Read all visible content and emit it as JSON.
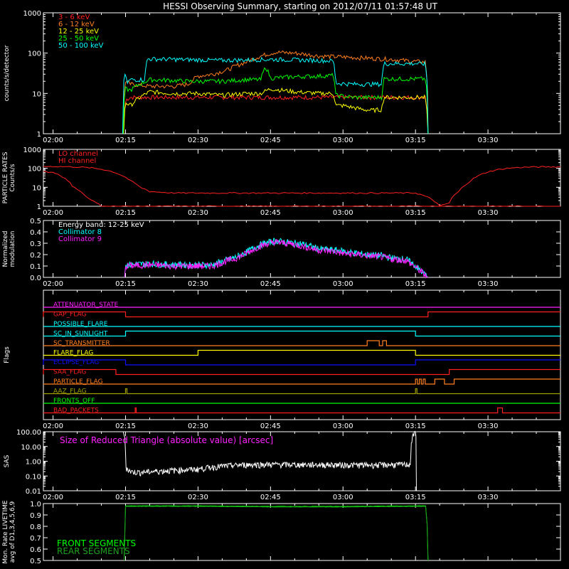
{
  "title": "HESSI Observing Summary, starting on 2012/07/11 01:57:48 UT",
  "colors": {
    "background": "#000000",
    "axis": "#ffffff",
    "red": "#ff2020",
    "orange": "#ff7f1f",
    "yellow": "#ffff00",
    "green": "#00ff00",
    "cyan": "#00ffff",
    "magenta": "#ff20ff",
    "blue": "#1010ff",
    "olive": "#a0a000",
    "white": "#ffffff",
    "darkgreen": "#20a020"
  },
  "time_axis": {
    "start_min": 118,
    "end_min": 225,
    "ticks": [
      {
        "t": 120,
        "label": "02:00"
      },
      {
        "t": 135,
        "label": "02:15"
      },
      {
        "t": 150,
        "label": "02:30"
      },
      {
        "t": 165,
        "label": "02:45"
      },
      {
        "t": 180,
        "label": "03:00"
      },
      {
        "t": 195,
        "label": "03:15"
      },
      {
        "t": 210,
        "label": "03:30"
      }
    ]
  },
  "chart_data": [
    {
      "type": "line",
      "panel": "count-rates",
      "ylabel": "counts/s/detector",
      "yscale": "log",
      "ylim": [
        1,
        1000
      ],
      "yticks": [
        {
          "v": 1,
          "label": "1"
        },
        {
          "v": 10,
          "label": "10"
        },
        {
          "v": 100,
          "label": "100"
        },
        {
          "v": 1000,
          "label": "1000"
        }
      ],
      "x_unit": "minutes of day (UT)",
      "series": [
        {
          "name": "3 - 6 keV",
          "color": "#ff2020",
          "x": [
            134.5,
            135.1,
            136,
            140,
            145,
            150,
            155,
            160,
            165,
            170,
            175,
            180,
            185,
            188,
            190,
            195,
            197,
            197.6
          ],
          "y": [
            1,
            7,
            8,
            8,
            8,
            8,
            8,
            8,
            8,
            8,
            8,
            8,
            8,
            8,
            8,
            8,
            8,
            1
          ]
        },
        {
          "name": "6 - 12 keV",
          "color": "#ff7f1f",
          "x": [
            134.5,
            135,
            136,
            140,
            145,
            148,
            150,
            153,
            156,
            160,
            163,
            166,
            170,
            175,
            180,
            185,
            190,
            195,
            197,
            197.6
          ],
          "y": [
            1,
            20,
            17,
            15,
            15,
            17,
            27,
            30,
            38,
            60,
            85,
            105,
            100,
            85,
            80,
            75,
            70,
            62,
            60,
            1
          ]
        },
        {
          "name": "12 - 25 keV",
          "color": "#ffff00",
          "x": [
            134.6,
            135,
            136,
            140,
            145,
            150,
            155,
            160,
            163,
            165,
            170,
            175,
            178,
            178.5,
            180,
            184,
            186,
            188,
            188.5,
            190,
            195,
            197,
            197.6
          ],
          "y": [
            1,
            6,
            5,
            11,
            10,
            10,
            9,
            10,
            10,
            13,
            11,
            10,
            10,
            5,
            5,
            4,
            3.8,
            4,
            8,
            8,
            8,
            8,
            1
          ]
        },
        {
          "name": "25 - 50 keV",
          "color": "#00ff00",
          "x": [
            134.5,
            135,
            136,
            140,
            145,
            148,
            150,
            155,
            160,
            163,
            164,
            165,
            170,
            175,
            178,
            178.5,
            182,
            185,
            188,
            188.5,
            190,
            195,
            197,
            197.6
          ],
          "y": [
            1,
            13,
            12,
            22,
            21,
            20,
            20,
            20,
            22,
            22,
            45,
            24,
            26,
            27,
            28,
            9,
            8,
            8,
            8,
            23,
            23,
            23,
            23,
            1
          ]
        },
        {
          "name": "50 - 100 keV",
          "color": "#00ffff",
          "x": [
            134.4,
            134.8,
            135.3,
            136,
            139,
            139.5,
            145,
            150,
            155,
            160,
            165,
            170,
            175,
            178,
            178.5,
            182,
            185,
            188,
            188.5,
            190,
            195,
            197,
            197.6
          ],
          "y": [
            1,
            33,
            18,
            22,
            22,
            72,
            70,
            68,
            66,
            68,
            70,
            68,
            66,
            64,
            18,
            17,
            17,
            17,
            55,
            55,
            55,
            54,
            1
          ]
        }
      ]
    },
    {
      "type": "line",
      "panel": "particle-rates",
      "ylabel": "PARTICLE RATES\nCounts/s",
      "yscale": "log",
      "ylim": [
        1,
        1000
      ],
      "yticks": [
        {
          "v": 1,
          "label": "1"
        },
        {
          "v": 10,
          "label": "10"
        },
        {
          "v": 100,
          "label": "100"
        },
        {
          "v": 1000,
          "label": "1000"
        }
      ],
      "series": [
        {
          "name": "LO channel",
          "color": "#ff2020",
          "x": [
            118,
            120,
            122,
            124,
            126,
            128,
            130,
            132,
            134,
            136,
            138,
            140,
            145,
            150,
            155,
            160,
            165,
            170,
            175,
            180,
            185,
            190,
            195,
            200,
            202,
            204,
            206,
            208,
            210,
            212,
            214,
            216,
            218,
            220,
            225
          ],
          "y": [
            125,
            125,
            123,
            120,
            115,
            105,
            90,
            70,
            45,
            22,
            10,
            6,
            5,
            5,
            5,
            5,
            5,
            5,
            5,
            5,
            5,
            5,
            5,
            1,
            1.5,
            6,
            18,
            40,
            65,
            85,
            100,
            110,
            115,
            118,
            120
          ]
        },
        {
          "name": "HI channel",
          "color": "#ff2020",
          "x": [
            118,
            120,
            121,
            122,
            123,
            124,
            125,
            126,
            127,
            128,
            129,
            130,
            132,
            135,
            140,
            145,
            150,
            160,
            170,
            180,
            190,
            195,
            200,
            202,
            203,
            210,
            225
          ],
          "y": [
            70,
            60,
            50,
            35,
            22,
            12,
            8,
            5,
            3,
            2,
            1.5,
            1,
            1,
            1,
            1,
            1,
            1,
            1,
            1,
            1,
            1,
            1,
            1,
            1,
            1,
            1,
            1
          ]
        }
      ]
    },
    {
      "type": "line",
      "panel": "modulation",
      "ylabel": "Normalized\nmodulation",
      "yscale": "linear",
      "ylim": [
        0,
        0.5
      ],
      "yticks": [
        {
          "v": 0,
          "label": "0.0"
        },
        {
          "v": 0.1,
          "label": "0.1"
        },
        {
          "v": 0.2,
          "label": "0.2"
        },
        {
          "v": 0.3,
          "label": "0.3"
        },
        {
          "v": 0.4,
          "label": "0.4"
        },
        {
          "v": 0.5,
          "label": "0.5"
        }
      ],
      "legend_header": "Energy band: 12-25 keV",
      "series": [
        {
          "name": "Collimator 8",
          "color": "#00ffff",
          "x": [
            134.8,
            135,
            140,
            145,
            150,
            153,
            155,
            158,
            160,
            162,
            164,
            166,
            168,
            170,
            172,
            175,
            178,
            180,
            183,
            185,
            188,
            190,
            193,
            195,
            197.6
          ],
          "y": [
            0,
            0.11,
            0.12,
            0.11,
            0.11,
            0.11,
            0.14,
            0.18,
            0.22,
            0.27,
            0.3,
            0.32,
            0.31,
            0.3,
            0.29,
            0.25,
            0.24,
            0.23,
            0.21,
            0.2,
            0.19,
            0.17,
            0.16,
            0.1,
            0
          ]
        },
        {
          "name": "Collimator 9",
          "color": "#ff20ff",
          "x": [
            134.8,
            135,
            140,
            145,
            150,
            153,
            155,
            158,
            160,
            162,
            164,
            166,
            168,
            170,
            172,
            175,
            178,
            180,
            183,
            185,
            188,
            190,
            193,
            195,
            197.6
          ],
          "y": [
            0,
            0.1,
            0.11,
            0.1,
            0.1,
            0.1,
            0.13,
            0.17,
            0.21,
            0.26,
            0.29,
            0.31,
            0.3,
            0.29,
            0.27,
            0.24,
            0.23,
            0.21,
            0.2,
            0.19,
            0.18,
            0.16,
            0.15,
            0.09,
            0
          ]
        }
      ]
    },
    {
      "type": "line",
      "panel": "flags",
      "ylabel": "Flags",
      "series": [
        {
          "name": "ATTENUATOR_STATE",
          "color": "#ff20ff",
          "transitions": []
        },
        {
          "name": "GAP_FLAG",
          "color": "#ff2020",
          "transitions": [
            [
              118,
              1
            ],
            [
              135,
              0
            ],
            [
              197.6,
              1
            ]
          ]
        },
        {
          "name": "POSSIBLE_FLARE",
          "color": "#00ffff",
          "transitions": []
        },
        {
          "name": "SC_IN_SUNLIGHT",
          "color": "#00ffff",
          "transitions": [
            [
              118,
              0
            ],
            [
              135,
              1
            ],
            [
              195,
              0
            ]
          ]
        },
        {
          "name": "SC_TRANSMITTER",
          "color": "#ff7f1f",
          "transitions": [
            [
              118,
              0
            ],
            [
              185,
              1
            ],
            [
              187.5,
              0
            ],
            [
              188.2,
              1
            ],
            [
              189,
              0
            ]
          ]
        },
        {
          "name": "FLARE_FLAG",
          "color": "#ffff00",
          "transitions": [
            [
              118,
              0
            ],
            [
              150,
              1
            ],
            [
              195,
              0
            ]
          ]
        },
        {
          "name": "ECLIPSE_FLAG",
          "color": "#1010ff",
          "transitions": [
            [
              118,
              1
            ],
            [
              135,
              0
            ],
            [
              195,
              1
            ]
          ]
        },
        {
          "name": "SAA_FLAG",
          "color": "#ff2020",
          "transitions": [
            [
              118,
              1
            ],
            [
              133,
              0
            ],
            [
              202,
              1
            ]
          ]
        },
        {
          "name": "PARTICLE_FLAG",
          "color": "#ff7f1f",
          "transitions": [
            [
              118,
              0
            ],
            [
              195,
              1
            ],
            [
              195.4,
              0
            ],
            [
              195.8,
              1
            ],
            [
              196.2,
              0
            ],
            [
              196.6,
              1
            ],
            [
              197,
              0
            ],
            [
              199,
              1
            ],
            [
              201,
              0
            ],
            [
              203,
              1
            ]
          ]
        },
        {
          "name": "AAZ_FLAG",
          "color": "#a0a000",
          "transitions": [
            [
              118,
              0
            ],
            [
              135,
              1
            ],
            [
              135.3,
              0
            ],
            [
              195,
              1
            ],
            [
              195.3,
              0
            ]
          ]
        },
        {
          "name": "FRONTS_OFF",
          "color": "#00ff00",
          "transitions": []
        },
        {
          "name": "BAD_PACKETS",
          "color": "#ff2020",
          "transitions": [
            [
              118,
              0
            ],
            [
              137,
              1
            ],
            [
              137.2,
              0
            ],
            [
              212,
              1
            ],
            [
              213,
              0
            ]
          ]
        }
      ]
    },
    {
      "type": "line",
      "panel": "sas",
      "ylabel": "SAS",
      "yscale": "log",
      "ylim": [
        0.01,
        100
      ],
      "yticks": [
        {
          "v": 0.01,
          "label": "0.01"
        },
        {
          "v": 0.1,
          "label": "0.10"
        },
        {
          "v": 1,
          "label": "1.00"
        },
        {
          "v": 10,
          "label": "10.00"
        },
        {
          "v": 100,
          "label": "100.00"
        }
      ],
      "annotation": "Size of Reduced Triangle (absolute value) [arcsec]",
      "series": [
        {
          "color": "#ffffff",
          "x": [
            134.5,
            135,
            136,
            138,
            140,
            142,
            145,
            148,
            150,
            152,
            154,
            156,
            158,
            160,
            165,
            170,
            175,
            180,
            185,
            190,
            194,
            195,
            195.2
          ],
          "y": [
            100,
            0.4,
            0.2,
            0.18,
            0.2,
            0.22,
            0.25,
            0.28,
            0.3,
            0.38,
            0.45,
            0.5,
            0.55,
            0.6,
            0.62,
            0.6,
            0.6,
            0.58,
            0.57,
            0.6,
            0.62,
            100,
            0.01
          ]
        }
      ]
    },
    {
      "type": "line",
      "panel": "livetime",
      "ylabel": "Mon. Rate LIVETIME\navg of D1,3,4,5,6,9",
      "yscale": "linear",
      "ylim": [
        0.5,
        1.0
      ],
      "yticks": [
        {
          "v": 0.5,
          "label": "0.5"
        },
        {
          "v": 0.6,
          "label": "0.6"
        },
        {
          "v": 0.7,
          "label": "0.7"
        },
        {
          "v": 0.8,
          "label": "0.8"
        },
        {
          "v": 0.9,
          "label": "0.9"
        },
        {
          "v": 1.0,
          "label": "1.0"
        }
      ],
      "series": [
        {
          "name": "FRONT SEGMENTS",
          "color": "#00ff00",
          "x": [
            134.7,
            135,
            150,
            165,
            180,
            195,
            197.3,
            197.6
          ],
          "y": [
            0.5,
            0.98,
            0.98,
            0.975,
            0.975,
            0.98,
            0.98,
            0.5
          ]
        },
        {
          "name": "REAR SEGMENTS",
          "color": "#20a020",
          "x": [
            134.7,
            135,
            150,
            165,
            180,
            195,
            197.3,
            197.6
          ],
          "y": [
            0.5,
            0.975,
            0.975,
            0.97,
            0.97,
            0.975,
            0.975,
            0.5
          ]
        }
      ]
    }
  ]
}
